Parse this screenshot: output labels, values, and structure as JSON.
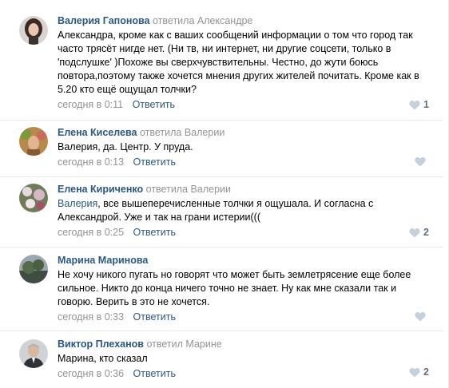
{
  "comments": [
    {
      "author": "Валерия Гапонова",
      "replied": "ответила",
      "reply_to": "Александре",
      "mention": "",
      "text": "Александра, кроме как с ваших сообщений информации о том что город так часто трясёт нигде нет. (Ни тв, ни интернет, ни другие соцсети, только в 'подслушке' )Похоже вы сверхчувствительны. Честно, до жути боюсь повтора,поэтому также хочется мнения других жителей почитать. Кроме как в 5.20 кто ещё ощущал толчки?",
      "time": "сегодня в 0:11",
      "reply_label": "Ответить",
      "likes": "1",
      "avatar": "woman-dark-hair-avatar"
    },
    {
      "author": "Елена Киселева",
      "replied": "ответила",
      "reply_to": "Валерии",
      "mention": "",
      "text": "Валерия, да. Центр. У пруда.",
      "time": "сегодня в 0:13",
      "reply_label": "Ответить",
      "likes": "",
      "avatar": "woman-flowers-avatar"
    },
    {
      "author": "Елена Кириченко",
      "replied": "ответила",
      "reply_to": "Валерии",
      "mention": "Валерия",
      "text": ", все вышеперечисленные толчки я ощушала. И согласна с Александрой. Уже и так на грани истерии(((",
      "time": "сегодня в 0:25",
      "reply_label": "Ответить",
      "likes": "2",
      "avatar": "floral-avatar"
    },
    {
      "author": "Марина Маринова",
      "replied": "",
      "reply_to": "",
      "mention": "",
      "text": "Не хочу никого пугать но говорят что может быть землетрясение еще более сильное. Никто до конца ничего точно не знает. Ну как мне сказали так и говорю. Верить в это не хочется.",
      "time": "сегодня в 0:33",
      "reply_label": "Ответить",
      "likes": "",
      "avatar": "landscape-avatar"
    },
    {
      "author": "Виктор Плеханов",
      "replied": "ответил",
      "reply_to": "Марине",
      "mention": "",
      "text": "Марина, кто сказал",
      "time": "сегодня в 0:36",
      "reply_label": "Ответить",
      "likes": "2",
      "avatar": "man-suit-avatar"
    }
  ],
  "colors": {
    "link": "#2a5885",
    "muted": "#939393",
    "like_icon": "#c5d0db",
    "like_count": "#5c6e80",
    "divider": "#e7e8ec"
  },
  "icons": {
    "like": "heart-icon"
  }
}
